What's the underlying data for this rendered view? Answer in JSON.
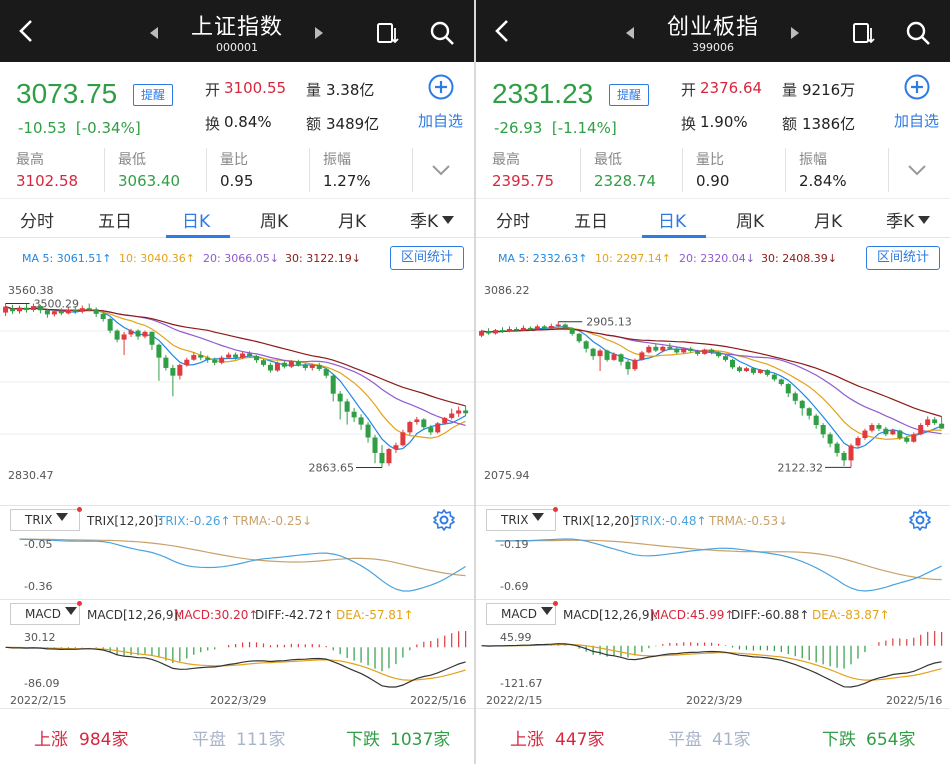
{
  "panels": [
    {
      "title": "上证指数",
      "code": "000001",
      "price": "3073.75",
      "remind_label": "提醒",
      "change": "-10.53",
      "change_pct": "[-0.34%]",
      "open_label": "开",
      "open": "3100.55",
      "volume_label": "量",
      "volume": "3.38亿",
      "turnover_label": "换",
      "turnover": "0.84%",
      "amount_label": "额",
      "amount": "3489亿",
      "add_label": "加自选",
      "stats": [
        {
          "label": "最高",
          "value": "3102.58",
          "color": "red"
        },
        {
          "label": "最低",
          "value": "3063.40",
          "color": "green"
        },
        {
          "label": "量比",
          "value": "0.95",
          "color": "none"
        },
        {
          "label": "振幅",
          "value": "1.27%",
          "color": "none"
        }
      ],
      "tabs": [
        "分时",
        "五日",
        "日K",
        "周K",
        "月K",
        "季K"
      ],
      "active_tab": 2,
      "ma_legend": [
        {
          "label": "MA 5: 3061.51↑",
          "color": "#1e88e5"
        },
        {
          "label": "10: 3040.36↑",
          "color": "#e3a21a"
        },
        {
          "label": "20: 3066.05↓",
          "color": "#8e5bd0"
        },
        {
          "label": "30: 3122.19↓",
          "color": "#8b1a1a"
        }
      ],
      "range_label": "区间统计",
      "kline": {
        "axis_top": "3560.38",
        "axis_bottom": "2830.47",
        "max_label": "3500.29",
        "min_label": "2863.65",
        "y_range": [
          2830.47,
          3560.38
        ],
        "max": 3500.29,
        "min": 2863.65,
        "candles": [
          [
            3465,
            3488,
            3501,
            3452
          ],
          [
            3480,
            3470,
            3495,
            3460
          ],
          [
            3470,
            3484,
            3492,
            3461
          ],
          [
            3484,
            3475,
            3498,
            3465
          ],
          [
            3475,
            3490,
            3500,
            3468
          ],
          [
            3490,
            3474,
            3495,
            3462
          ],
          [
            3474,
            3458,
            3480,
            3445
          ],
          [
            3458,
            3470,
            3478,
            3450
          ],
          [
            3470,
            3462,
            3482,
            3455
          ],
          [
            3462,
            3476,
            3485,
            3458
          ],
          [
            3476,
            3468,
            3490,
            3460
          ],
          [
            3468,
            3482,
            3492,
            3462
          ],
          [
            3482,
            3478,
            3500,
            3470
          ],
          [
            3478,
            3460,
            3485,
            3448
          ],
          [
            3460,
            3440,
            3468,
            3430
          ],
          [
            3440,
            3395,
            3445,
            3385
          ],
          [
            3395,
            3360,
            3400,
            3350
          ],
          [
            3360,
            3380,
            3390,
            3300
          ],
          [
            3380,
            3395,
            3402,
            3370
          ],
          [
            3395,
            3372,
            3400,
            3360
          ],
          [
            3372,
            3390,
            3395,
            3365
          ],
          [
            3390,
            3340,
            3392,
            3320
          ],
          [
            3340,
            3290,
            3345,
            3200
          ],
          [
            3290,
            3250,
            3300,
            3240
          ],
          [
            3250,
            3220,
            3262,
            3140
          ],
          [
            3220,
            3262,
            3266,
            3205
          ],
          [
            3262,
            3282,
            3290,
            3255
          ],
          [
            3282,
            3300,
            3310,
            3278
          ],
          [
            3300,
            3290,
            3315,
            3280
          ],
          [
            3290,
            3282,
            3298,
            3270
          ],
          [
            3282,
            3270,
            3290,
            3260
          ],
          [
            3270,
            3290,
            3298,
            3264
          ],
          [
            3290,
            3302,
            3310,
            3285
          ],
          [
            3302,
            3290,
            3310,
            3282
          ],
          [
            3290,
            3306,
            3312,
            3285
          ],
          [
            3306,
            3296,
            3315,
            3290
          ],
          [
            3296,
            3280,
            3300,
            3270
          ],
          [
            3280,
            3262,
            3285,
            3255
          ],
          [
            3262,
            3240,
            3270,
            3232
          ],
          [
            3240,
            3270,
            3275,
            3235
          ],
          [
            3270,
            3255,
            3278,
            3248
          ],
          [
            3255,
            3275,
            3280,
            3250
          ],
          [
            3275,
            3262,
            3282,
            3255
          ],
          [
            3262,
            3250,
            3268,
            3240
          ],
          [
            3250,
            3262,
            3266,
            3240
          ],
          [
            3262,
            3246,
            3270,
            3238
          ],
          [
            3246,
            3220,
            3250,
            3210
          ],
          [
            3220,
            3150,
            3225,
            3120
          ],
          [
            3150,
            3120,
            3160,
            3050
          ],
          [
            3120,
            3080,
            3130,
            3030
          ],
          [
            3080,
            3058,
            3095,
            3040
          ],
          [
            3058,
            3030,
            3070,
            3010
          ],
          [
            3030,
            2980,
            3040,
            2960
          ],
          [
            2980,
            2920,
            2990,
            2880
          ],
          [
            2920,
            2880,
            2950,
            2864
          ],
          [
            2880,
            2935,
            2940,
            2870
          ],
          [
            2935,
            2950,
            2960,
            2920
          ],
          [
            2950,
            3000,
            3010,
            2945
          ],
          [
            3000,
            3040,
            3045,
            2990
          ],
          [
            3040,
            3050,
            3060,
            3030
          ],
          [
            3050,
            3020,
            3055,
            3010
          ],
          [
            3020,
            3000,
            3028,
            2990
          ],
          [
            3000,
            3035,
            3040,
            2995
          ],
          [
            3035,
            3056,
            3060,
            3030
          ],
          [
            3056,
            3073,
            3092,
            3050
          ],
          [
            3073,
            3085,
            3100,
            3060
          ],
          [
            3085,
            3074,
            3103,
            3063
          ]
        ]
      },
      "trix": {
        "select": "TRIX",
        "params": "TRIX[12,20]:",
        "trix": "TRIX:-0.26↑",
        "trma": "TRMA:-0.25↓",
        "top": "-0.05",
        "bottom": "-0.36"
      },
      "macd": {
        "select": "MACD",
        "params": "MACD[12,26,9]:",
        "macd": "MACD:30.20↑",
        "diff": "DIFF:-42.72↑",
        "dea": "DEA:-57.81↑",
        "top": "30.12",
        "bottom": "-86.09"
      },
      "dates": [
        "2022/2/15",
        "2022/3/29",
        "2022/5/16"
      ],
      "breadth": {
        "up_label": "上涨",
        "up": "984家",
        "flat_label": "平盘",
        "flat": "111家",
        "down_label": "下跌",
        "down": "1037家"
      }
    },
    {
      "title": "创业板指",
      "code": "399006",
      "price": "2331.23",
      "remind_label": "提醒",
      "change": "-26.93",
      "change_pct": "[-1.14%]",
      "open_label": "开",
      "open": "2376.64",
      "volume_label": "量",
      "volume": "9216万",
      "turnover_label": "换",
      "turnover": "1.90%",
      "amount_label": "额",
      "amount": "1386亿",
      "add_label": "加自选",
      "stats": [
        {
          "label": "最高",
          "value": "2395.75",
          "color": "red"
        },
        {
          "label": "最低",
          "value": "2328.74",
          "color": "green"
        },
        {
          "label": "量比",
          "value": "0.90",
          "color": "none"
        },
        {
          "label": "振幅",
          "value": "2.84%",
          "color": "none"
        }
      ],
      "tabs": [
        "分时",
        "五日",
        "日K",
        "周K",
        "月K",
        "季K"
      ],
      "active_tab": 2,
      "ma_legend": [
        {
          "label": "MA 5: 2332.63↑",
          "color": "#1e88e5"
        },
        {
          "label": "10: 2297.14↑",
          "color": "#e3a21a"
        },
        {
          "label": "20: 2320.04↓",
          "color": "#8e5bd0"
        },
        {
          "label": "30: 2408.39↓",
          "color": "#8b1a1a"
        }
      ],
      "range_label": "区间统计",
      "kline": {
        "axis_top": "3086.22",
        "axis_bottom": "2075.94",
        "max_label": "2905.13",
        "min_label": "2122.32",
        "y_range": [
          2075.94,
          3086.22
        ],
        "max": 2905.13,
        "min": 2122.32,
        "candles": [
          [
            2830,
            2855,
            2862,
            2822
          ],
          [
            2855,
            2842,
            2870,
            2835
          ],
          [
            2842,
            2860,
            2866,
            2836
          ],
          [
            2860,
            2852,
            2875,
            2845
          ],
          [
            2852,
            2866,
            2880,
            2848
          ],
          [
            2866,
            2858,
            2876,
            2850
          ],
          [
            2858,
            2872,
            2885,
            2855
          ],
          [
            2872,
            2864,
            2880,
            2856
          ],
          [
            2864,
            2880,
            2890,
            2860
          ],
          [
            2880,
            2870,
            2888,
            2862
          ],
          [
            2870,
            2882,
            2895,
            2866
          ],
          [
            2882,
            2890,
            2905,
            2878
          ],
          [
            2890,
            2870,
            2896,
            2860
          ],
          [
            2870,
            2840,
            2875,
            2830
          ],
          [
            2840,
            2800,
            2845,
            2790
          ],
          [
            2800,
            2760,
            2806,
            2740
          ],
          [
            2760,
            2720,
            2765,
            2700
          ],
          [
            2720,
            2750,
            2760,
            2640
          ],
          [
            2750,
            2700,
            2755,
            2690
          ],
          [
            2700,
            2730,
            2740,
            2695
          ],
          [
            2730,
            2690,
            2735,
            2670
          ],
          [
            2690,
            2650,
            2700,
            2620
          ],
          [
            2650,
            2700,
            2708,
            2640
          ],
          [
            2700,
            2740,
            2748,
            2695
          ],
          [
            2740,
            2770,
            2780,
            2735
          ],
          [
            2770,
            2750,
            2785,
            2742
          ],
          [
            2750,
            2770,
            2776,
            2740
          ],
          [
            2770,
            2760,
            2790,
            2752
          ],
          [
            2760,
            2740,
            2768,
            2732
          ],
          [
            2740,
            2760,
            2766,
            2734
          ],
          [
            2760,
            2748,
            2770,
            2738
          ],
          [
            2748,
            2732,
            2755,
            2722
          ],
          [
            2732,
            2755,
            2760,
            2728
          ],
          [
            2755,
            2740,
            2762,
            2730
          ],
          [
            2740,
            2720,
            2746,
            2712
          ],
          [
            2720,
            2700,
            2726,
            2690
          ],
          [
            2700,
            2660,
            2706,
            2650
          ],
          [
            2660,
            2640,
            2668,
            2632
          ],
          [
            2640,
            2655,
            2662,
            2635
          ],
          [
            2655,
            2630,
            2660,
            2620
          ],
          [
            2630,
            2645,
            2650,
            2625
          ],
          [
            2645,
            2620,
            2650,
            2610
          ],
          [
            2620,
            2595,
            2628,
            2585
          ],
          [
            2595,
            2570,
            2600,
            2560
          ],
          [
            2570,
            2520,
            2575,
            2500
          ],
          [
            2520,
            2480,
            2530,
            2460
          ],
          [
            2480,
            2440,
            2485,
            2400
          ],
          [
            2440,
            2400,
            2445,
            2380
          ],
          [
            2400,
            2350,
            2410,
            2330
          ],
          [
            2350,
            2300,
            2360,
            2280
          ],
          [
            2300,
            2250,
            2310,
            2230
          ],
          [
            2250,
            2200,
            2260,
            2180
          ],
          [
            2200,
            2160,
            2210,
            2130
          ],
          [
            2160,
            2240,
            2250,
            2122
          ],
          [
            2240,
            2280,
            2290,
            2230
          ],
          [
            2280,
            2320,
            2330,
            2270
          ],
          [
            2320,
            2350,
            2360,
            2310
          ],
          [
            2350,
            2330,
            2360,
            2318
          ],
          [
            2330,
            2300,
            2340,
            2290
          ],
          [
            2300,
            2320,
            2330,
            2295
          ],
          [
            2320,
            2280,
            2325,
            2270
          ],
          [
            2280,
            2260,
            2290,
            2250
          ],
          [
            2260,
            2300,
            2310,
            2255
          ],
          [
            2300,
            2350,
            2360,
            2295
          ],
          [
            2350,
            2380,
            2396,
            2340
          ],
          [
            2380,
            2360,
            2392,
            2350
          ],
          [
            2357,
            2331,
            2396,
            2329
          ]
        ]
      },
      "trix": {
        "select": "TRIX",
        "params": "TRIX[12,20]:",
        "trix": "TRIX:-0.48↑",
        "trma": "TRMA:-0.53↓",
        "top": "-0.19",
        "bottom": "-0.69"
      },
      "macd": {
        "select": "MACD",
        "params": "MACD[12,26,9]:",
        "macd": "MACD:45.99↑",
        "diff": "DIFF:-60.88↑",
        "dea": "DEA:-83.87↑",
        "top": "45.99",
        "bottom": "-121.67"
      },
      "dates": [
        "2022/2/15",
        "2022/3/29",
        "2022/5/16"
      ],
      "breadth": {
        "up_label": "上涨",
        "up": "447家",
        "flat_label": "平盘",
        "flat": "41家",
        "down_label": "下跌",
        "down": "654家"
      }
    }
  ],
  "colors": {
    "up": "#e03a3e",
    "down": "#2f9e44",
    "accent": "#2e7be6",
    "trix": "#4aa3df",
    "trma": "#c9a26b",
    "macd_line": "#333333",
    "dea_line": "#e3a21a"
  }
}
